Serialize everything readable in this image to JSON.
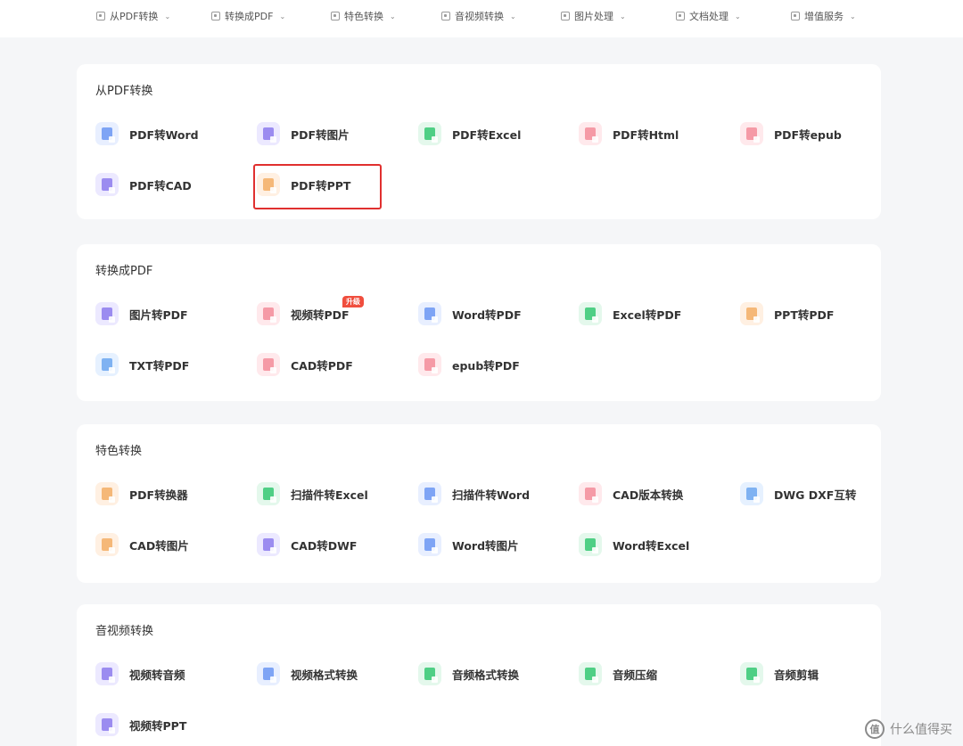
{
  "topnav": [
    {
      "label": "从PDF转换",
      "icon": "pdf-icon"
    },
    {
      "label": "转换成PDF",
      "icon": "convert-icon"
    },
    {
      "label": "特色转换",
      "icon": "star-icon"
    },
    {
      "label": "音视频转换",
      "icon": "media-icon"
    },
    {
      "label": "图片处理",
      "icon": "image-icon"
    },
    {
      "label": "文档处理",
      "icon": "document-icon"
    },
    {
      "label": "增值服务",
      "icon": "service-icon"
    }
  ],
  "sections": [
    {
      "title": "从PDF转换",
      "items": [
        "PDF转Word",
        "PDF转图片",
        "PDF转Excel",
        "PDF转Html",
        "PDF转epub",
        "PDF转CAD",
        "PDF转PPT"
      ]
    },
    {
      "title": "转换成PDF",
      "items": [
        "图片转PDF",
        "视频转PDF",
        "Word转PDF",
        "Excel转PDF",
        "PPT转PDF",
        "TXT转PDF",
        "CAD转PDF",
        "epub转PDF"
      ],
      "badge": "升级"
    },
    {
      "title": "特色转换",
      "items": [
        "PDF转换器",
        "扫描件转Excel",
        "扫描件转Word",
        "CAD版本转换",
        "DWG DXF互转",
        "CAD转图片",
        "CAD转DWF",
        "Word转图片",
        "Word转Excel"
      ]
    },
    {
      "title": "音视频转换",
      "items": [
        "视频转音频",
        "视频格式转换",
        "音频格式转换",
        "音频压缩",
        "音频剪辑",
        "视频转PPT"
      ]
    }
  ],
  "icon_colors": {
    "blue": "#7ea4f5",
    "purple": "#9b8cf0",
    "green": "#4fcf85",
    "red": "#f59aa6",
    "orange": "#f5b878",
    "highlight": "#e0302f",
    "badge": "#f04e3e"
  },
  "watermark": {
    "logo": "值",
    "text": "什么值得买"
  }
}
